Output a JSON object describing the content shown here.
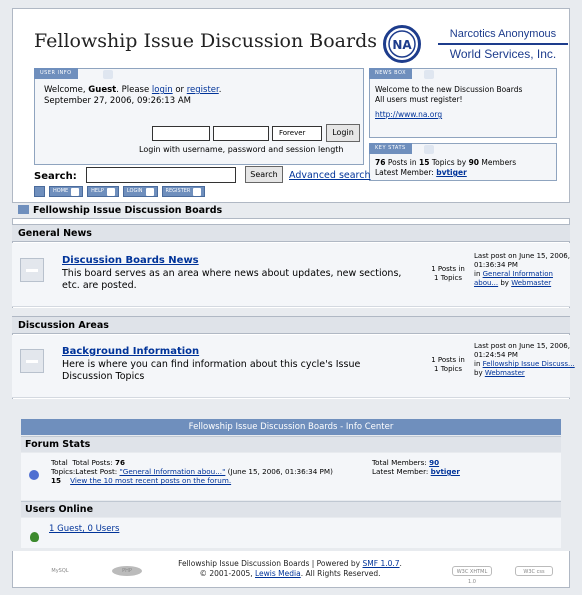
{
  "header": {
    "title": "Fellowship Issue Discussion Boards",
    "org_line1": "Narcotics Anonymous",
    "org_line2": "World Services, Inc."
  },
  "user_info": {
    "tab_label": "USER INFO",
    "welcome_prefix": "Welcome, ",
    "guest": "Guest",
    "please": ". Please ",
    "login_link": "login",
    "or": " or ",
    "register_link": "register",
    "period": ".",
    "datetime": "September 27, 2006, 09:26:13 AM",
    "session_length": "Forever",
    "login_button": "Login",
    "login_hint": "Login with username, password and session length"
  },
  "news_box": {
    "tab_label": "NEWS BOX",
    "line1": "Welcome to the new Discussion Boards",
    "line2": "All users must register!",
    "url": "http://www.na.org"
  },
  "key_stats": {
    "tab_label": "KEY STATS",
    "posts": "76",
    "posts_in": " Posts in ",
    "topics": "15",
    "topics_by": " Topics by ",
    "members": "90",
    "members_label": " Members",
    "latest_label": "Latest Member: ",
    "latest_member": "bvtiger"
  },
  "search": {
    "label": "Search:",
    "button": "Search",
    "advanced": "Advanced search"
  },
  "nav": {
    "items": [
      {
        "label": "HOME"
      },
      {
        "label": "HELP"
      },
      {
        "label": "LOGIN"
      },
      {
        "label": "REGISTER"
      }
    ]
  },
  "breadcrumb": "Fellowship Issue Discussion Boards",
  "categories": [
    {
      "name": "General News",
      "board": {
        "title": "Discussion Boards News",
        "description": "This board serves as an area where news about updates, new sections, etc. are posted.",
        "posts": "1 Posts in",
        "topics": "1 Topics",
        "last_post": "Last post on June 15, 2006, 01:36:34 PM",
        "in_label": "in ",
        "last_topic": "General Information abou...",
        "by_label": " by ",
        "last_author": "Webmaster"
      }
    },
    {
      "name": "Discussion Areas",
      "board": {
        "title": "Background Information",
        "description": "Here is where you can find information about this cycle's Issue Discussion Topics",
        "posts": "1 Posts in",
        "topics": "1 Topics",
        "last_post": "Last post on June 15, 2006, 01:24:54 PM",
        "in_label": "in ",
        "last_topic": "Fellowship Issue Discuss...",
        "by_label": "by ",
        "last_author": "Webmaster"
      }
    }
  ],
  "info_center": {
    "header": "Fellowship Issue Discussion Boards - Info Center",
    "forum_stats_title": "Forum Stats",
    "total_label": "Total",
    "total_posts_label": "Total Posts: ",
    "total_posts": "76",
    "topics_label": "Topics:",
    "latest_post_label": "Latest Post: ",
    "latest_post_link": "\"General Information abou...\"",
    "latest_post_date": " (June 15, 2006, 01:36:34 PM)",
    "topics_count": "15",
    "recent_posts_link": "View the 10 most recent posts on the forum.",
    "total_members_label": "Total Members: ",
    "total_members": "90",
    "latest_member_label": "Latest Member: ",
    "latest_member": "bvtiger",
    "users_online_title": "Users Online",
    "users_online_link": "1 Guest, 0 Users"
  },
  "footer": {
    "line1_prefix": "Fellowship Issue Discussion Boards | Powered by ",
    "smf_link": "SMF 1.0.7",
    "line1_suffix": ".",
    "line2_prefix": "© 2001-2005, ",
    "lewis_link": "Lewis Media",
    "line2_suffix": ". All Rights Reserved.",
    "badges": [
      "MySQL",
      "PHP",
      "W3C XHTML 1.0",
      "W3C css"
    ]
  },
  "colors": {
    "accent": "#6f8fbd",
    "link": "#003399",
    "brand": "#1d3c8c"
  }
}
